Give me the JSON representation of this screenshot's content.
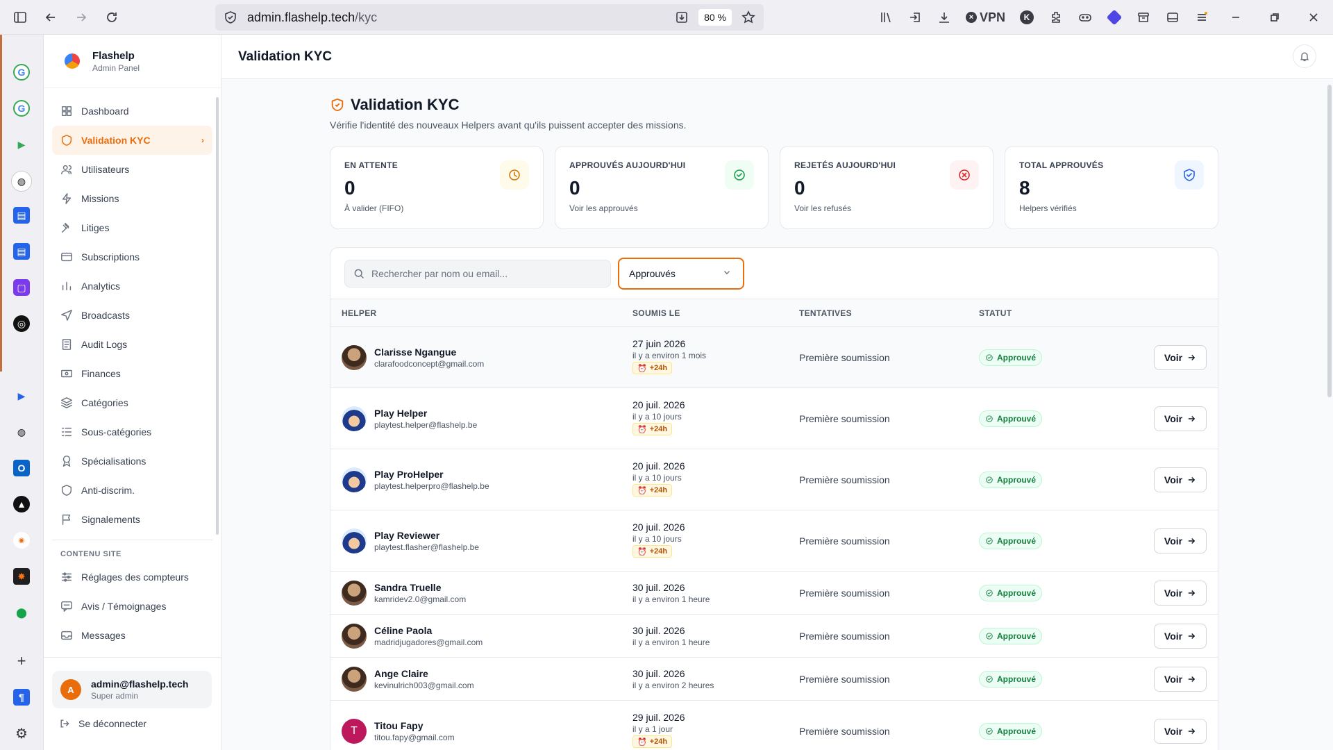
{
  "browser": {
    "url_host": "admin.flashelp.tech",
    "url_path": "/kyc",
    "zoom": "80 %",
    "vpn_label": "VPN"
  },
  "brand": {
    "name": "Flashelp",
    "subtitle": "Admin Panel"
  },
  "sidebar": {
    "items": [
      {
        "label": "Dashboard",
        "icon": "grid-icon"
      },
      {
        "label": "Validation KYC",
        "icon": "shield-icon",
        "active": true
      },
      {
        "label": "Utilisateurs",
        "icon": "users-icon"
      },
      {
        "label": "Missions",
        "icon": "zap-icon"
      },
      {
        "label": "Litiges",
        "icon": "gavel-icon"
      },
      {
        "label": "Subscriptions",
        "icon": "card-icon"
      },
      {
        "label": "Analytics",
        "icon": "chart-icon"
      },
      {
        "label": "Broadcasts",
        "icon": "send-icon"
      },
      {
        "label": "Audit Logs",
        "icon": "log-icon"
      },
      {
        "label": "Finances",
        "icon": "money-icon"
      },
      {
        "label": "Catégories",
        "icon": "layers-icon"
      },
      {
        "label": "Sous-catégories",
        "icon": "list-icon"
      },
      {
        "label": "Spécialisations",
        "icon": "award-icon"
      },
      {
        "label": "Anti-discrim.",
        "icon": "shield-icon"
      },
      {
        "label": "Signalements",
        "icon": "flag-icon"
      }
    ],
    "section_label": "CONTENU SITE",
    "site_items": [
      {
        "label": "Réglages des compteurs",
        "icon": "sliders-icon"
      },
      {
        "label": "Avis / Témoignages",
        "icon": "message-icon"
      },
      {
        "label": "Messages",
        "icon": "inbox-icon"
      }
    ],
    "user": {
      "initial": "A",
      "email": "admin@flashelp.tech",
      "role": "Super admin"
    },
    "logout_label": "Se déconnecter"
  },
  "header": {
    "title": "Validation KYC"
  },
  "page": {
    "title": "Validation KYC",
    "subtitle": "Vérifie l'identité des nouveaux Helpers avant qu'ils puissent accepter des missions."
  },
  "stats": [
    {
      "label": "EN ATTENTE",
      "value": "0",
      "sub": "À valider (FIFO)",
      "icon": "clock-icon",
      "color": "#d97706",
      "bg": "#fffbeb"
    },
    {
      "label": "APPROUVÉS AUJOURD'HUI",
      "value": "0",
      "sub": "Voir les approuvés",
      "icon": "check-circle-icon",
      "color": "#16a34a",
      "bg": "#f0fdf4"
    },
    {
      "label": "REJETÉS AUJOURD'HUI",
      "value": "0",
      "sub": "Voir les refusés",
      "icon": "x-circle-icon",
      "color": "#dc2626",
      "bg": "#fef2f2"
    },
    {
      "label": "TOTAL APPROUVÉS",
      "value": "8",
      "sub": "Helpers vérifiés",
      "icon": "shield-check-icon",
      "color": "#2563eb",
      "bg": "#eff6ff"
    }
  ],
  "filters": {
    "search_placeholder": "Rechercher par nom ou email...",
    "status_value": "Approuvés"
  },
  "table": {
    "columns": [
      "HELPER",
      "SOUMIS LE",
      "TENTATIVES",
      "STATUT"
    ],
    "rows": [
      {
        "name": "Clarisse Ngangue",
        "email": "clarafoodconcept@gmail.com",
        "date": "27 juin 2026",
        "relative": "il y a environ 1 mois",
        "late": "+24h",
        "attempts": "Première soumission",
        "status": "Approuvé",
        "action": "Voir",
        "avatar": "photo"
      },
      {
        "name": "Play Helper",
        "email": "playtest.helper@flashelp.be",
        "date": "20 juil. 2026",
        "relative": "il y a 10 jours",
        "late": "+24h",
        "attempts": "Première soumission",
        "status": "Approuvé",
        "action": "Voir",
        "avatar": "cap"
      },
      {
        "name": "Play ProHelper",
        "email": "playtest.helperpro@flashelp.be",
        "date": "20 juil. 2026",
        "relative": "il y a 10 jours",
        "late": "+24h",
        "attempts": "Première soumission",
        "status": "Approuvé",
        "action": "Voir",
        "avatar": "cap"
      },
      {
        "name": "Play Reviewer",
        "email": "playtest.flasher@flashelp.be",
        "date": "20 juil. 2026",
        "relative": "il y a 10 jours",
        "late": "+24h",
        "attempts": "Première soumission",
        "status": "Approuvé",
        "action": "Voir",
        "avatar": "cap"
      },
      {
        "name": "Sandra Truelle",
        "email": "kamridev2.0@gmail.com",
        "date": "30 juil. 2026",
        "relative": "il y a environ 1 heure",
        "late": null,
        "attempts": "Première soumission",
        "status": "Approuvé",
        "action": "Voir",
        "avatar": "photo"
      },
      {
        "name": "Céline Paola",
        "email": "madridjugadores@gmail.com",
        "date": "30 juil. 2026",
        "relative": "il y a environ 1 heure",
        "late": null,
        "attempts": "Première soumission",
        "status": "Approuvé",
        "action": "Voir",
        "avatar": "photo"
      },
      {
        "name": "Ange Claire",
        "email": "kevinulrich003@gmail.com",
        "date": "30 juil. 2026",
        "relative": "il y a environ 2 heures",
        "late": null,
        "attempts": "Première soumission",
        "status": "Approuvé",
        "action": "Voir",
        "avatar": "photo"
      },
      {
        "name": "Titou Fapy",
        "email": "titou.fapy@gmail.com",
        "date": "29 juil. 2026",
        "relative": "il y a 1 jour",
        "late": "+24h",
        "attempts": "Première soumission",
        "status": "Approuvé",
        "action": "Voir",
        "avatar": "letter",
        "initial": "T"
      }
    ]
  }
}
